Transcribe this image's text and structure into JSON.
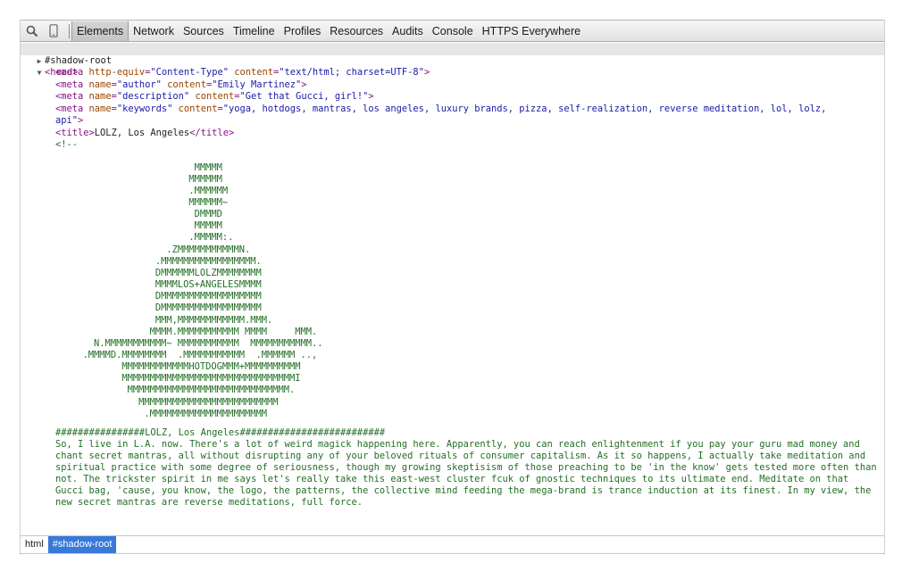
{
  "toolbar": {
    "icons": [
      "search-icon",
      "device-icon"
    ],
    "tabs": [
      "Elements",
      "Network",
      "Sources",
      "Timeline",
      "Profiles",
      "Resources",
      "Audits",
      "Console",
      "HTTPS Everywhere"
    ],
    "selected_tab": "Elements"
  },
  "dom": {
    "shadow_root": "#shadow-root",
    "head_open": "<head>",
    "meta1": {
      "tag_start": "<meta ",
      "attr1_name": "http-equiv",
      "attr1_value": "\"Content-Type\"",
      "attr2_name": "content",
      "attr2_value": "\"text/html; charset=UTF-8\"",
      "tag_end": ">"
    },
    "meta2": {
      "tag_start": "<meta ",
      "attr1_name": "name",
      "attr1_value": "\"author\"",
      "attr2_name": "content",
      "attr2_value": "\"Emily Martinez\"",
      "tag_end": ">"
    },
    "meta3": {
      "tag_start": "<meta ",
      "attr1_name": "name",
      "attr1_value": "\"description\"",
      "attr2_name": "content",
      "attr2_value": "\"Get that Gucci, girl!\"",
      "tag_end": ">"
    },
    "meta4": {
      "tag_start": "<meta ",
      "attr1_name": "name",
      "attr1_value": "\"keywords\"",
      "attr2_name": "content",
      "attr2_value_line1": "\"yoga, hotdogs, mantras, los angeles, luxury brands, pizza, self-realization, reverse meditation, lol, lolz,",
      "attr2_value_line2": "api\"",
      "tag_end": ">"
    },
    "title": {
      "open": "<title>",
      "text": "LOLZ, Los Angeles",
      "close": "</title>"
    },
    "comment_open": "<!--",
    "ascii_art": [
      "                          MMMMM",
      "                         MMMMMM",
      "                         .MMMMMM",
      "                         MMMMMM~",
      "                          DMMMD",
      "                          MMMMM",
      "                         .MMMMM:.",
      "                     .ZMMMMMMMMMMMN.",
      "                   .MMMMMMMMMMMMMMMMM.",
      "                   DMMMMMMLOLZMMMMMMMM",
      "                   MMMMLOS+ANGELESMMMM",
      "                   DMMMMMMMMMMMMMMMMMM",
      "                   DMMMMMMMMMMMMMMMMMM",
      "                   MMM,MMMMMMMMMMMM.MMM.",
      "                  MMMM.MMMMMMMMMMM MMMM     MMM.",
      "        N.MMMMMMMMMMM~ MMMMMMMMMMM  MMMMMMMMMMM..",
      "      .MMMMD.MMMMMMMM  .MMMMMMMMMMM  .MMMMMM ..,",
      "             MMMMMMMMMMMMHOTDOGMMM+MMMMMMMMMM",
      "             MMMMMMMMMMMMMMMMMMMMMMMMMMMMMMMI",
      "              MMMMMMMMMMMMMMMMMMMMMMMMMMMMM.",
      "                MMMMMMMMMMMMMMMMMMMMMMMMM",
      "                 .MMMMMMMMMMMMMMMMMMMMM"
    ],
    "story_heading": "################LOLZ, Los Angeles##########################",
    "story_text": "So, I live in L.A. now. There's a lot of weird magick happening here. Apparently, you can reach enlightenment if you pay your guru mad money and chant secret mantras, all without disrupting any of your beloved rituals of consumer capitalism. As it so happens, I actually take meditation and spiritual practice with some degree of seriousness, though my growing skeptisism of those preaching to be 'in the know' gets tested more often than not. The trickster spirit in me says let's really take this east-west cluster fcuk of gnostic techniques to its ultimate end. Meditate on that Gucci bag, 'cause, you know, the logo, the patterns, the collective mind feeding the mega-brand is trance induction at its finest. In my view, the new secret mantras are reverse meditations, full force."
  },
  "breadcrumbs": [
    "html",
    "#shadow-root"
  ],
  "selected_crumb": "#shadow-root",
  "colors": {
    "tag": "#881280",
    "attribute_name": "#994500",
    "attribute_value": "#1a1aa6",
    "comment": "#236e25",
    "selection": "#3879d9"
  }
}
